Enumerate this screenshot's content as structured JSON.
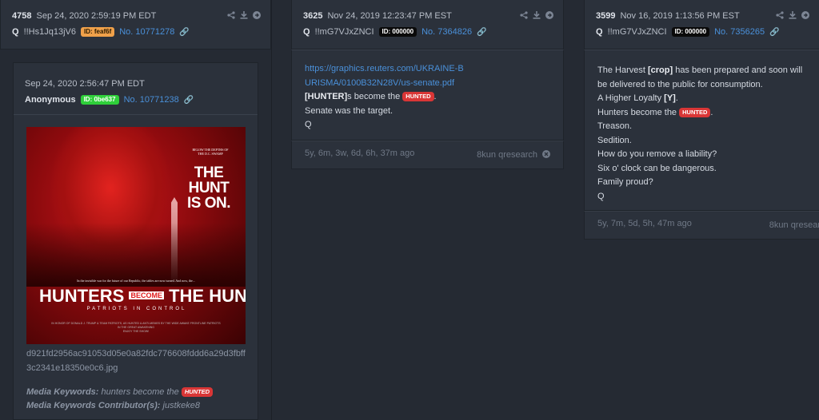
{
  "columns": [
    {
      "post_number": "4758",
      "date": "Sep 24, 2020 2:59:19 PM EDT",
      "author": "Q",
      "tripcode": "!!Hs1Jq13jV6",
      "id_label": "ID: feaf6f",
      "post_link": "No. 10771278",
      "quoted": {
        "date": "Sep 24, 2020 2:56:47 PM EDT",
        "author": "Anonymous",
        "id_label": "ID: 0be637",
        "post_link": "No. 10771238",
        "image_text": {
          "tagline": "BELOW THE DEPTHS OF THE D.C. SWAMP",
          "headline": "THE HUNT IS ON.",
          "subline": "In the invisible war for the future of our Republic, the tables are now turned. And now, the...",
          "title_left": "HUNTERS",
          "title_mid": "BECOME",
          "title_right": "THE HUNTED",
          "tagline2": "PATRIOTS IN CONTROL",
          "credits": "IN HONOR OF DONALD J. TRUMP & TEAM PATRIOTS, AS HUNTED & ANTI-MEMES BY THE WIDE AWAKE FRONTLINE PATRIOTS IN THE GREAT AWAKENING",
          "credits2": "ENJOY THE SHOW!"
        },
        "filename": "d921fd2956ac91053d05e0a82fdc776608fddd6a29d3fbff3c2341e18350e0c6.jpg",
        "keywords_label": "Media Keywords:",
        "keywords_value": "hunters become the",
        "keywords_badge": "HUNTED",
        "contributors_label": "Media Keywords Contributor(s):",
        "contributors_value": "justkeke8"
      }
    },
    {
      "post_number": "3625",
      "date": "Nov 24, 2019 12:23:47 PM EST",
      "author": "Q",
      "tripcode": "!!mG7VJxZNCI",
      "id_label": "ID: 000000",
      "post_link": "No. 7364826",
      "body": {
        "url": "https://graphics.reuters.com/UKRAINE-BURISMA/0100B32N28V/us-senate.pdf",
        "line2_bold": "[HUNTER]",
        "line2_text": "s become the",
        "badge": "HUNTED",
        "line2_end": ".",
        "line3": "Senate was the target.",
        "line4": "Q"
      },
      "footer": {
        "age": "5y, 6m, 3w, 6d, 6h, 37m ago",
        "source": "8kun qresearch"
      }
    },
    {
      "post_number": "3599",
      "date": "Nov 16, 2019 1:13:56 PM EST",
      "author": "Q",
      "tripcode": "!!mG7VJxZNCI",
      "id_label": "ID: 000000",
      "post_link": "No. 7356265",
      "body": {
        "l1a": "The Harvest ",
        "l1b": "[crop]",
        "l1c": " has been prepared and soon will be delivered to the public for consumption.",
        "l2a": "A Higher Loyalty ",
        "l2b": "[Y]",
        "l2c": ".",
        "l3a": "Hunters become the ",
        "l3badge": "HUNTED",
        "l3c": ".",
        "l4": "Treason.",
        "l5": "Sedition.",
        "l6": "How do you remove a liability?",
        "l7": "Six o' clock can be dangerous.",
        "l8": "Family proud?",
        "l9": "Q"
      },
      "footer": {
        "age": "5y, 7m, 5d, 5h, 47m ago",
        "source": "8kun qresear"
      }
    }
  ],
  "icons": [
    "share-icon",
    "download-icon",
    "arrow-right-icon",
    "link-icon",
    "close-circle-icon"
  ],
  "colors": {
    "background": "#252a33",
    "panel": "#2b313b",
    "link": "#4a90d9",
    "hunted_badge": "#d93636",
    "id_orange": "#f0a14a",
    "id_green": "#2fcf3a"
  }
}
